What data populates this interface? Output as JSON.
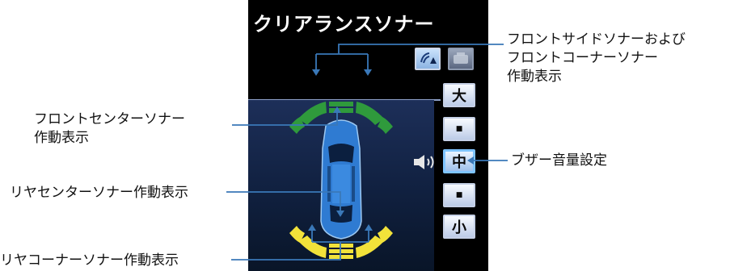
{
  "screen": {
    "title": "クリアランスソナー",
    "volume_buttons": [
      {
        "label": "大"
      },
      {
        "label": "■"
      },
      {
        "label": "中"
      },
      {
        "label": "■"
      },
      {
        "label": "小"
      }
    ],
    "selected_volume": "中",
    "front_sensor_color": "#2f9a3c",
    "rear_sensor_color": "#f2e23a",
    "car_color": "#2f7bd2"
  },
  "callouts": {
    "front_side": [
      "フロントサイドソナーおよび",
      "フロントコーナーソナー",
      "作動表示"
    ],
    "front_center": [
      "フロントセンターソナー",
      "作動表示"
    ],
    "buzzer": "ブザー音量設定",
    "rear_center": "リヤセンターソナー作動表示",
    "rear_corner": "リヤコーナーソナー作動表示"
  },
  "icons": {
    "mode_1": "sensor-display-icon",
    "mode_2": "camera-display-icon",
    "speaker": "speaker-icon"
  }
}
